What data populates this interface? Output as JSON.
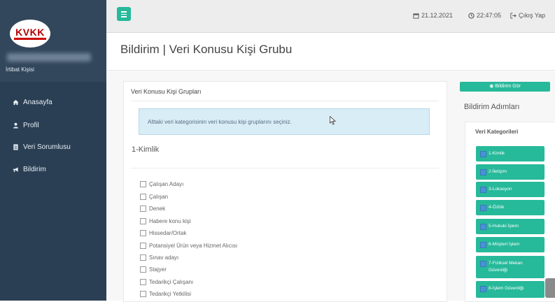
{
  "app": {
    "logo_text": "KVKK",
    "user_role": "İrtibat Kişisi"
  },
  "sidebar": {
    "items": [
      {
        "label": "Anasayfa",
        "icon": "home-icon"
      },
      {
        "label": "Profil",
        "icon": "user-icon"
      },
      {
        "label": "Veri Sorumlusu",
        "icon": "document-icon"
      },
      {
        "label": "Bildirim",
        "icon": "bullhorn-icon"
      }
    ]
  },
  "header": {
    "date": "21.12.2021",
    "time": "22:47:05",
    "logout_label": "Çıkış Yap"
  },
  "page": {
    "title": "Bildirim | Veri Konusu Kişi Grubu"
  },
  "panel": {
    "title": "Veri Konusu Kişi Grupları",
    "alert": "Alttaki veri kategorisinin veri konusu kişi gruplarını seçiniz.",
    "section": "1-Kimlik",
    "options": [
      "Çalışan Adayı",
      "Çalışan",
      "Denek",
      "Habere konu kişi",
      "Hissedar/Ortak",
      "Potansiyel Ürün veya Hizmet Alıcısı",
      "Sınav adayı",
      "Stajyer",
      "Tedarikçi Çalışanı",
      "Tedarikçi Yetkilisi"
    ]
  },
  "right": {
    "show_button": "Bildirim Gör",
    "steps_title": "Bildirim Adımları",
    "categories_title": "Veri Kategorileri",
    "steps": [
      "1-Kimlik",
      "2-İletişim",
      "3-Lokasyon",
      "4-Özlük",
      "5-Hukuki İşlem",
      "6-Müşteri İşlem",
      "7-Fiziksel Mekan Güvenliği",
      "8-İşlem Güvenliği"
    ]
  },
  "colors": {
    "sidebar": "#2a3f54",
    "accent": "#26b99a",
    "alert_bg": "#d9edf7"
  }
}
